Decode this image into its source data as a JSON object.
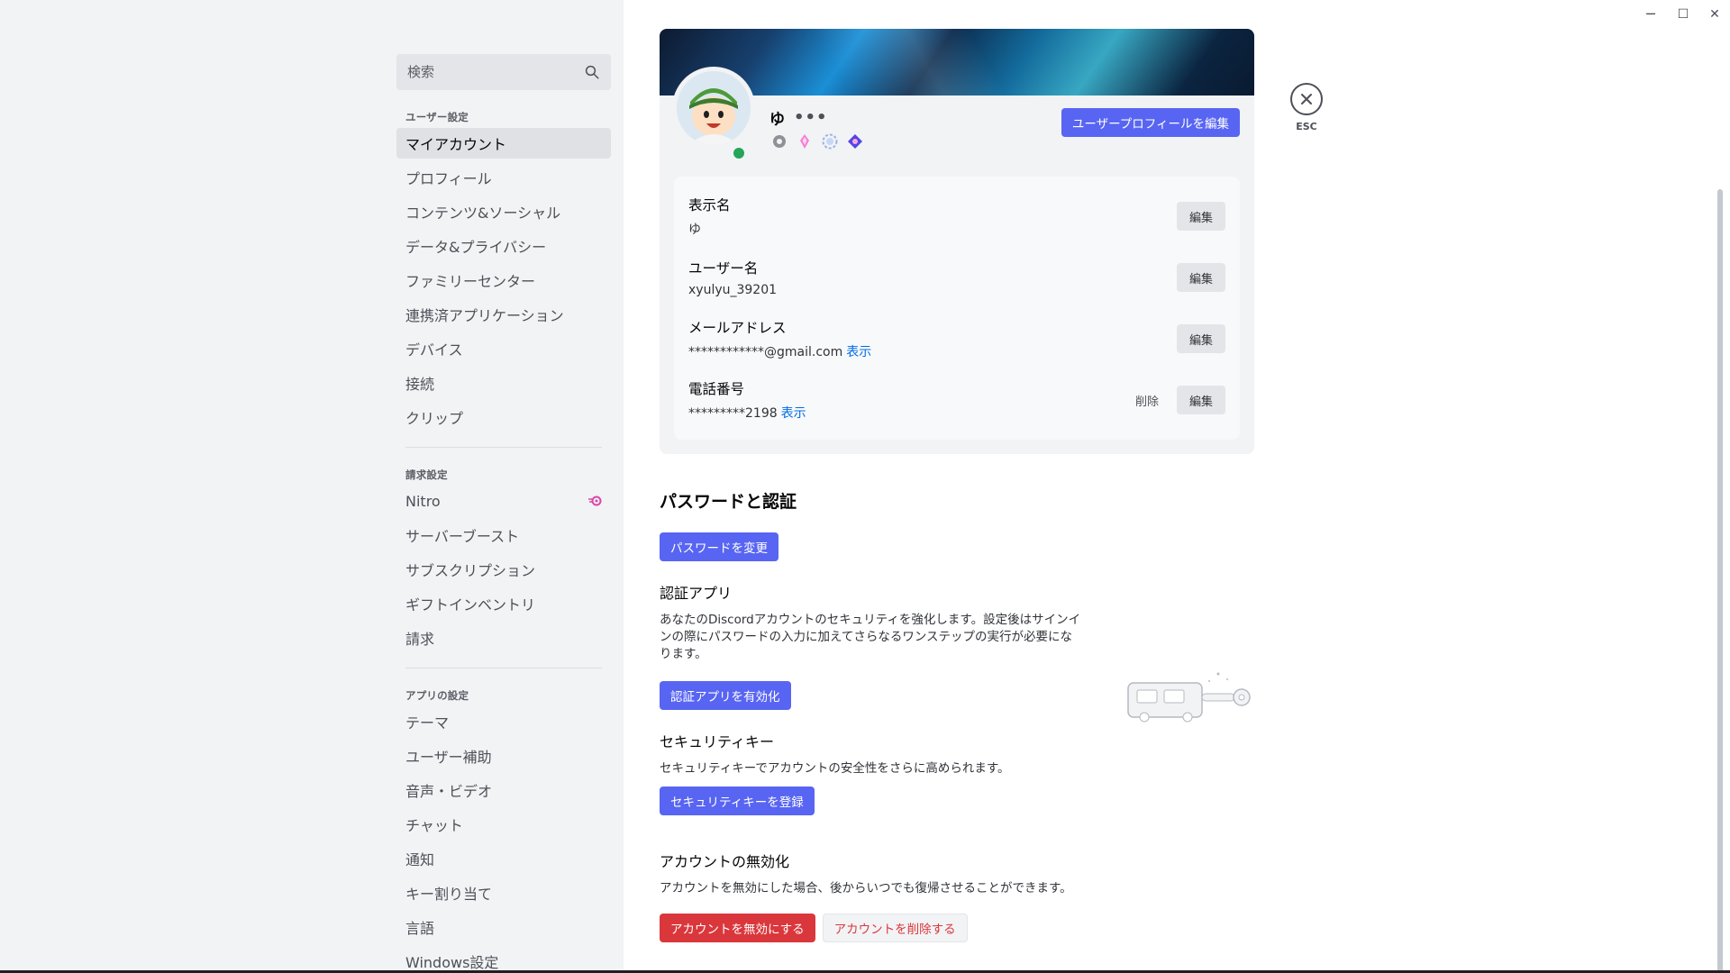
{
  "window": {
    "minimize": "─",
    "maximize": "☐",
    "close": "✕"
  },
  "sidebar": {
    "search_placeholder": "検索",
    "sections": [
      {
        "title": "ユーザー設定",
        "items": [
          "マイアカウント",
          "プロフィール",
          "コンテンツ&ソーシャル",
          "データ&プライバシー",
          "ファミリーセンター",
          "連携済アプリケーション",
          "デバイス",
          "接続",
          "クリップ"
        ]
      },
      {
        "title": "請求設定",
        "items": [
          "Nitro",
          "サーバーブースト",
          "サブスクリプション",
          "ギフトインベントリ",
          "請求"
        ]
      },
      {
        "title": "アプリの設定",
        "items": [
          "テーマ",
          "ユーザー補助",
          "音声・ビデオ",
          "チャット",
          "通知",
          "キー割り当て",
          "言語",
          "Windows設定"
        ]
      }
    ]
  },
  "profile": {
    "username": "ゆ",
    "more": "•••",
    "edit_profile_label": "ユーザープロフィールを編集",
    "status_color": "#23a55a"
  },
  "account_info": {
    "display_name_label": "表示名",
    "display_name_value": "ゆ",
    "username_label": "ユーザー名",
    "username_value": "xyulyu_39201",
    "email_label": "メールアドレス",
    "email_value": "************@gmail.com",
    "phone_label": "電話番号",
    "phone_value": "*********2198",
    "reveal_label": "表示",
    "edit_label": "編集",
    "remove_label": "削除"
  },
  "security": {
    "title": "パスワードと認証",
    "change_password_label": "パスワードを変更",
    "authenticator_title": "認証アプリ",
    "authenticator_desc_line1": "あなたのDiscordアカウントのセキュリティを強化します。設定後はサインイ",
    "authenticator_desc_line2": "ンの際にパスワードの入力に加えてさらなるワンステップの実行が必要にな",
    "authenticator_desc_line3": "ります。",
    "enable_authenticator_label": "認証アプリを有効化",
    "security_key_title": "セキュリティキー",
    "security_key_desc": "セキュリティキーでアカウントの安全性をさらに高められます。",
    "register_key_label": "セキュリティキーを登録",
    "disable_title": "アカウントの無効化",
    "disable_desc": "アカウントを無効にした場合、後からいつでも復帰させることができます。",
    "disable_label": "アカウントを無効にする",
    "delete_label": "アカウントを削除する"
  },
  "close": {
    "esc_label": "ESC"
  },
  "colors": {
    "accent": "#5865f2",
    "danger": "#da373c",
    "link": "#006ce7"
  }
}
